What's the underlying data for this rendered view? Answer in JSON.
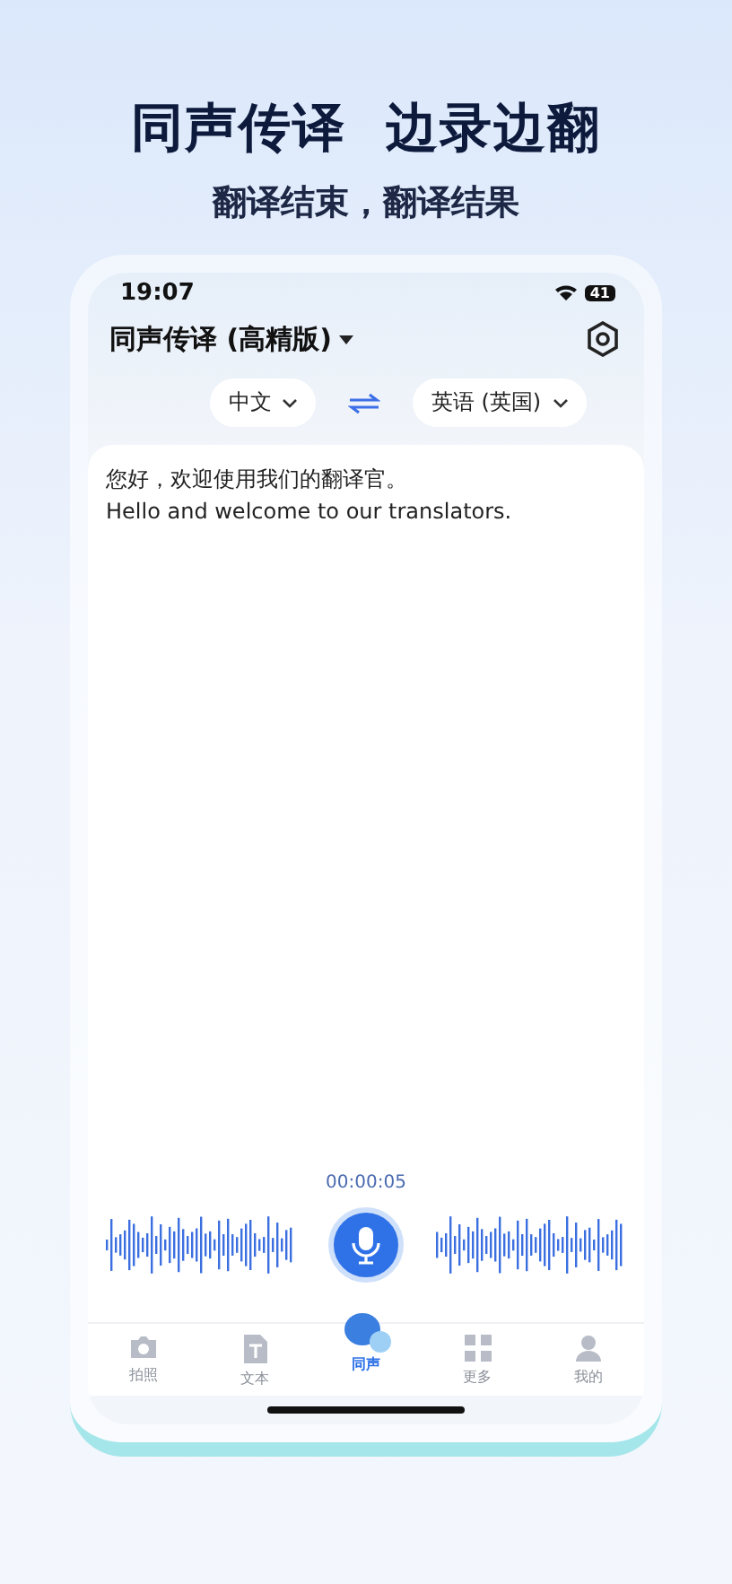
{
  "headline": {
    "title": "同声传译  边录边翻",
    "subtitle": "翻译结束，翻译结果"
  },
  "status_bar": {
    "time": "19:07",
    "battery": "41"
  },
  "header": {
    "title": "同声传译 (高精版)"
  },
  "languages": {
    "source": "中文",
    "target": "英语 (英国)"
  },
  "transcript": {
    "source_text": "您好，欢迎使用我们的翻译官。",
    "translation": "Hello and welcome to our translators."
  },
  "recording": {
    "timer": "00:00:05"
  },
  "tabs": [
    {
      "label": "拍照",
      "kind": "camera",
      "selected": false
    },
    {
      "label": "文本",
      "kind": "text",
      "selected": false
    },
    {
      "label": "同声",
      "kind": "voice",
      "selected": true
    },
    {
      "label": "更多",
      "kind": "more",
      "selected": false
    },
    {
      "label": "我的",
      "kind": "profile",
      "selected": false
    }
  ]
}
